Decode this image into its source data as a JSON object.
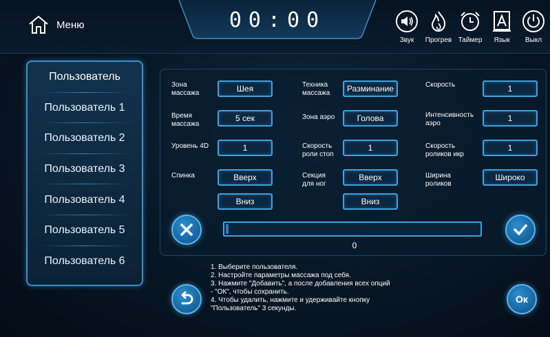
{
  "header": {
    "menu_label": "Меню",
    "timer": "00:00",
    "tools": [
      {
        "icon": "speaker-icon",
        "label": "Звук"
      },
      {
        "icon": "flame-icon",
        "label": "Прогрев"
      },
      {
        "icon": "alarm-clock-icon",
        "label": "Таймер"
      },
      {
        "icon": "language-icon",
        "label": "Язык"
      },
      {
        "icon": "power-icon",
        "label": "Выкл"
      }
    ]
  },
  "sidebar": {
    "items": [
      {
        "label": "Пользователь"
      },
      {
        "label": "Пользователь 1"
      },
      {
        "label": "Пользователь 2"
      },
      {
        "label": "Пользователь 3"
      },
      {
        "label": "Пользователь 4"
      },
      {
        "label": "Пользователь 5"
      },
      {
        "label": "Пользователь 6"
      }
    ]
  },
  "settings": {
    "massage_zone": {
      "label": "Зона массажа",
      "value": "Шея"
    },
    "time": {
      "label": "Время массажа",
      "value": "5 сек"
    },
    "level_4d": {
      "label": "Уровень 4D",
      "value": "1"
    },
    "back": {
      "label": "Спинка",
      "up": "Вверх",
      "down": "Вниз"
    },
    "technique": {
      "label": "Техника массажа",
      "value": "Разминание"
    },
    "air_zone": {
      "label": "Зона аэро",
      "value": "Голова"
    },
    "foot_roller_speed": {
      "label": "Скорость роли стоп",
      "value": "1"
    },
    "leg_section": {
      "label": "Секция для ног",
      "up": "Вверх",
      "down": "Вниз"
    },
    "speed": {
      "label": "Скорость",
      "value": "1"
    },
    "air_intensity": {
      "label": "Интенсивность аэро",
      "value": "1"
    },
    "calf_roller_speed": {
      "label": "Скорость роликов икр",
      "value": "1"
    },
    "roller_width": {
      "label": "Ширина роликов",
      "value": "Широко"
    }
  },
  "progress": {
    "value": 0,
    "label": "0"
  },
  "instructions": [
    "1. Выберите пользователя.",
    "2. Настройте параметры массажа под себя.",
    "3. Нажмите \"Добавить\", а после добавления всех опций",
    "- \"ОК\", чтобы сохранить.",
    "4. Чтобы удалить, нажмите и удерживайте кнопку",
    "\"Пользователь\" 3 секунды."
  ],
  "ok_label": "Ок"
}
